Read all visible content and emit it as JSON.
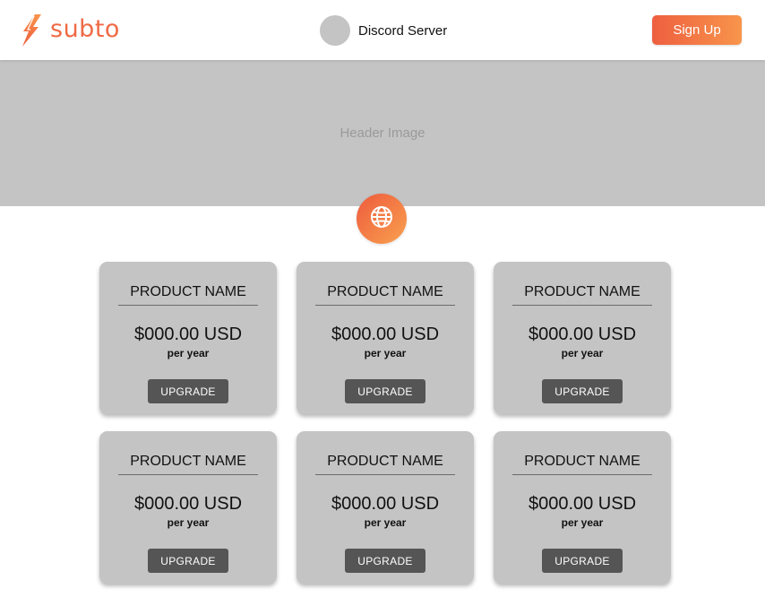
{
  "nav": {
    "logo_text": "subto",
    "server_name": "Discord Server",
    "signup_label": "Sign Up"
  },
  "header": {
    "placeholder": "Header Image",
    "badge_icon": "globe-icon"
  },
  "colors": {
    "accent_start": "#ee5f40",
    "accent_end": "#f8954b",
    "placeholder_gray": "#c4c4c4",
    "button_dark": "#555555"
  },
  "products": [
    {
      "name": "PRODUCT NAME",
      "price": "$000.00 USD",
      "period": "per year",
      "cta": "UPGRADE"
    },
    {
      "name": "PRODUCT NAME",
      "price": "$000.00 USD",
      "period": "per year",
      "cta": "UPGRADE"
    },
    {
      "name": "PRODUCT NAME",
      "price": "$000.00 USD",
      "period": "per year",
      "cta": "UPGRADE"
    },
    {
      "name": "PRODUCT NAME",
      "price": "$000.00 USD",
      "period": "per year",
      "cta": "UPGRADE"
    },
    {
      "name": "PRODUCT NAME",
      "price": "$000.00 USD",
      "period": "per year",
      "cta": "UPGRADE"
    },
    {
      "name": "PRODUCT NAME",
      "price": "$000.00 USD",
      "period": "per year",
      "cta": "UPGRADE"
    }
  ]
}
